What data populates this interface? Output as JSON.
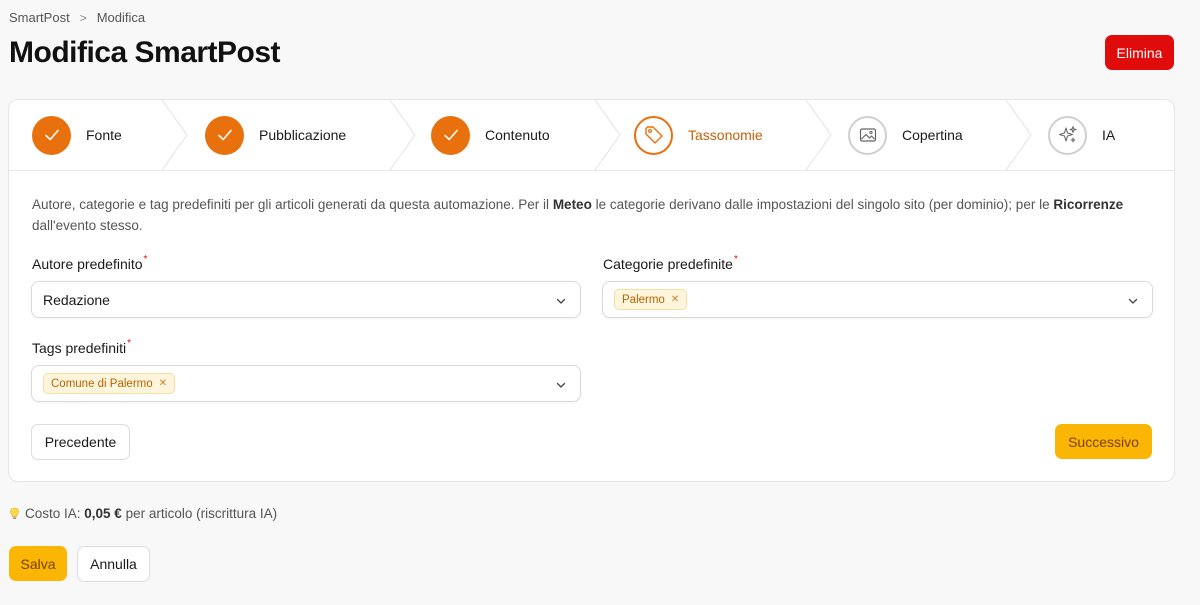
{
  "breadcrumb": {
    "root": "SmartPost",
    "separator": ">",
    "current": "Modifica"
  },
  "header": {
    "title": "Modifica SmartPost",
    "delete_label": "Elimina"
  },
  "steps": [
    {
      "label": "Fonte",
      "state": "done",
      "icon": "check-icon"
    },
    {
      "label": "Pubblicazione",
      "state": "done",
      "icon": "check-icon"
    },
    {
      "label": "Contenuto",
      "state": "done",
      "icon": "check-icon"
    },
    {
      "label": "Tassonomie",
      "state": "active",
      "icon": "tag-icon"
    },
    {
      "label": "Copertina",
      "state": "todo",
      "icon": "image-icon"
    },
    {
      "label": "IA",
      "state": "todo",
      "icon": "sparkles-icon"
    }
  ],
  "description": {
    "part1": "Autore, categorie e tag predefiniti per gli articoli generati da questa automazione. Per il ",
    "bold1": "Meteo",
    "part2": " le categorie derivano dalle impostazioni del singolo sito (per dominio); per le ",
    "bold2": "Ricorrenze",
    "part3": " dall'evento stesso."
  },
  "fields": {
    "author": {
      "label": "Autore predefinito",
      "required": "*",
      "value": "Redazione"
    },
    "categories": {
      "label": "Categorie predefinite",
      "required": "*",
      "tags": [
        "Palermo"
      ]
    },
    "tags": {
      "label": "Tags predefiniti",
      "required": "*",
      "tags": [
        "Comune di Palermo"
      ]
    }
  },
  "nav": {
    "previous_label": "Precedente",
    "next_label": "Successivo"
  },
  "cost": {
    "prefix": "Costo IA: ",
    "amount": "0,05 €",
    "suffix": " per articolo (riscrittura IA)",
    "icon": "lightbulb-icon"
  },
  "footer": {
    "save_label": "Salva",
    "cancel_label": "Annulla"
  },
  "colors": {
    "accent": "#e8700d",
    "danger": "#e00b0b",
    "primary_button": "#fbb605"
  }
}
